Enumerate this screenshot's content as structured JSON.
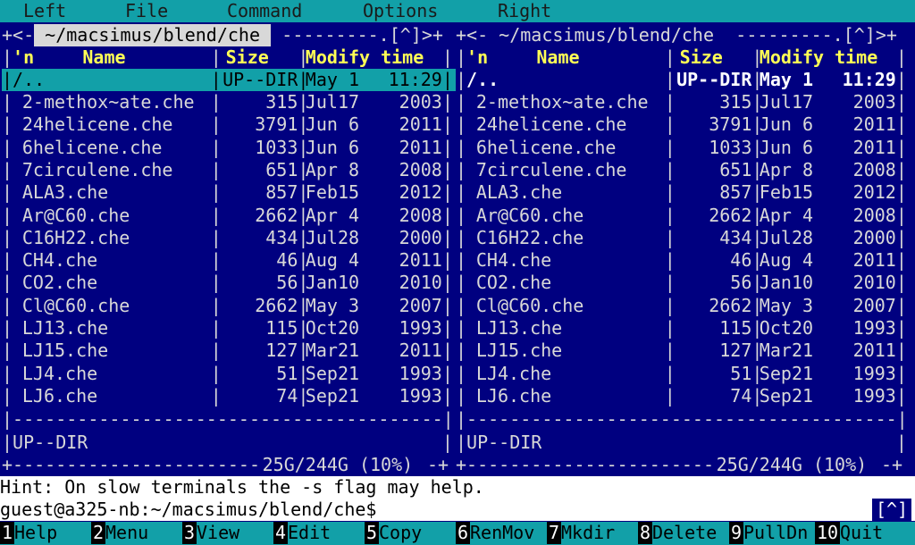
{
  "menu": [
    "Left",
    "File",
    "Command",
    "Options",
    "Right"
  ],
  "left_panel": {
    "path": " ~/macsimus/blend/che ",
    "top_left_glyph": "+<-",
    "top_dashes": " ---------.[^]>+",
    "headers": {
      "n": "'n",
      "name": "Name",
      "size": "Size",
      "mtime": "Modify time"
    },
    "parent": {
      "name": "/..",
      "size": "UP--DIR",
      "month": "May",
      "day": "1",
      "time": "11:29"
    },
    "status": "UP--DIR",
    "footer": "25G/244G (10%)"
  },
  "right_panel": {
    "path": " ~/macsimus/blend/che ",
    "top_left_glyph": "+<-",
    "top_dashes": " ---------.[^]>+",
    "headers": {
      "n": "'n",
      "name": "Name",
      "size": "Size",
      "mtime": "Modify time"
    },
    "parent": {
      "name": "/..",
      "size": "UP--DIR",
      "month": "May",
      "day": "1",
      "time": "11:29"
    },
    "status": "UP--DIR",
    "footer": "25G/244G (10%)"
  },
  "files": [
    {
      "name": "2-methox~ate.che",
      "size": "315",
      "month": "Jul",
      "day": "17",
      "year": "2003"
    },
    {
      "name": "24helicene.che",
      "size": "3791",
      "month": "Jun",
      "day": "6",
      "year": "2011"
    },
    {
      "name": "6helicene.che",
      "size": "1033",
      "month": "Jun",
      "day": "6",
      "year": "2011"
    },
    {
      "name": "7circulene.che",
      "size": "651",
      "month": "Apr",
      "day": "8",
      "year": "2008"
    },
    {
      "name": "ALA3.che",
      "size": "857",
      "month": "Feb",
      "day": "15",
      "year": "2012"
    },
    {
      "name": "Ar@C60.che",
      "size": "2662",
      "month": "Apr",
      "day": "4",
      "year": "2008"
    },
    {
      "name": "C16H22.che",
      "size": "434",
      "month": "Jul",
      "day": "28",
      "year": "2000"
    },
    {
      "name": "CH4.che",
      "size": "46",
      "month": "Aug",
      "day": "4",
      "year": "2011"
    },
    {
      "name": "CO2.che",
      "size": "56",
      "month": "Jan",
      "day": "10",
      "year": "2010"
    },
    {
      "name": "Cl@C60.che",
      "size": "2662",
      "month": "May",
      "day": "3",
      "year": "2007"
    },
    {
      "name": "LJ13.che",
      "size": "115",
      "month": "Oct",
      "day": "20",
      "year": "1993"
    },
    {
      "name": "LJ15.che",
      "size": "127",
      "month": "Mar",
      "day": "21",
      "year": "2011"
    },
    {
      "name": "LJ4.che",
      "size": "51",
      "month": "Sep",
      "day": "21",
      "year": "1993"
    },
    {
      "name": "LJ6.che",
      "size": "74",
      "month": "Sep",
      "day": "21",
      "year": "1993"
    }
  ],
  "hint": "Hint: On slow terminals the -s flag may help.",
  "prompt": "guest@a325-nb:~/macsimus/blend/che$",
  "prompt_indicator": "[^]",
  "fkeys": [
    {
      "num": "1",
      "label": "Help"
    },
    {
      "num": "2",
      "label": "Menu"
    },
    {
      "num": "3",
      "label": "View"
    },
    {
      "num": "4",
      "label": "Edit"
    },
    {
      "num": "5",
      "label": "Copy"
    },
    {
      "num": "6",
      "label": "RenMov"
    },
    {
      "num": "7",
      "label": "Mkdir"
    },
    {
      "num": "8",
      "label": "Delete"
    },
    {
      "num": "9",
      "label": "PullDn"
    },
    {
      "num": "10",
      "label": "Quit"
    }
  ],
  "colors": {
    "panel_bg": "#000080",
    "menu_bg": "#12a0a8",
    "header_text": "#ffff55",
    "cursor_bg": "#12a0a8"
  },
  "selected_row": "parent"
}
